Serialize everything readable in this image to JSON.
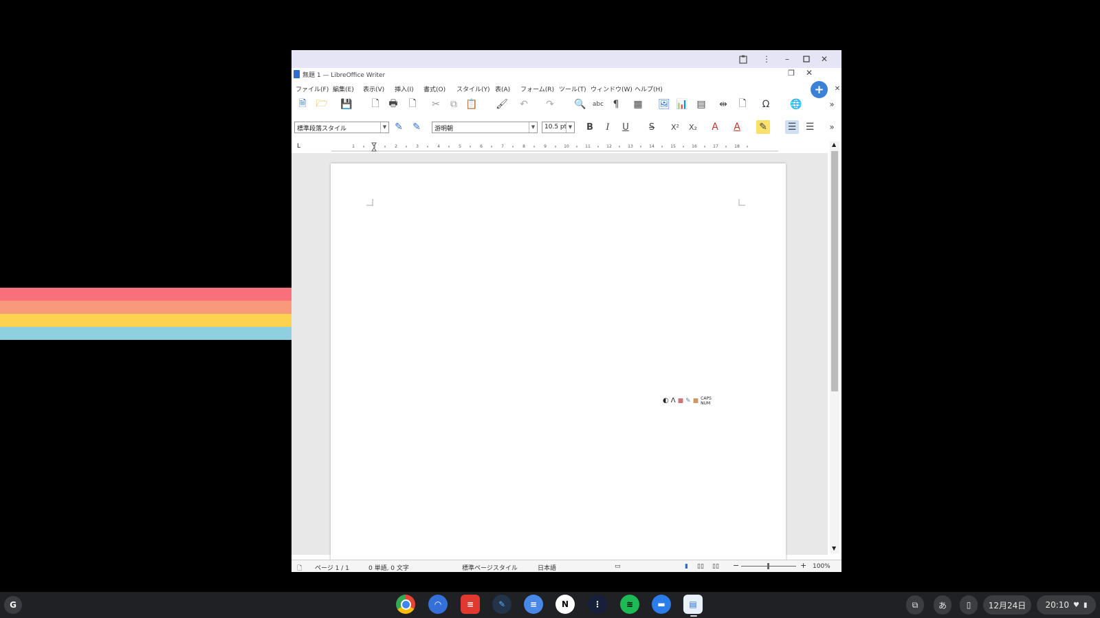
{
  "colors": {
    "stripes": [
      "#f8707a",
      "#f79a7a",
      "#fbd34f",
      "#8ed0e0"
    ],
    "chrome_bar": "#e6e5f5",
    "accent": "#3b82d6"
  },
  "window": {
    "title": "無題 1 — LibreOffice Writer",
    "menu": [
      "ファイル(F)",
      "編集(E)",
      "表示(V)",
      "挿入(I)",
      "書式(O)",
      "スタイル(Y)",
      "表(A)",
      "フォーム(R)",
      "ツール(T)",
      "ウィンドウ(W)",
      "ヘルプ(H)"
    ]
  },
  "format": {
    "paragraph_style": "標準段落スタイル",
    "font_name": "游明朝",
    "font_size": "10.5 pt"
  },
  "ruler": {
    "numbers": [
      "1",
      "1",
      "2",
      "3",
      "4",
      "5",
      "6",
      "7",
      "8",
      "9",
      "10",
      "11",
      "12",
      "13",
      "14",
      "15",
      "16",
      "17",
      "18"
    ]
  },
  "statusbar": {
    "page": "ページ 1 / 1",
    "words": "0 単語, 0 文字",
    "page_style": "標準ページスタイル",
    "language": "日本語",
    "zoom": "100%"
  },
  "floating_indicator": {
    "caps": "CAPS",
    "num": "NUM"
  },
  "shelf": {
    "launcher_letter": "G",
    "apps": [
      "chrome",
      "app-2",
      "todoist",
      "app-4",
      "docs",
      "notion",
      "app-7",
      "spotify",
      "files",
      "writer"
    ],
    "ime": "あ",
    "date": "12月24日",
    "time": "20:10"
  }
}
